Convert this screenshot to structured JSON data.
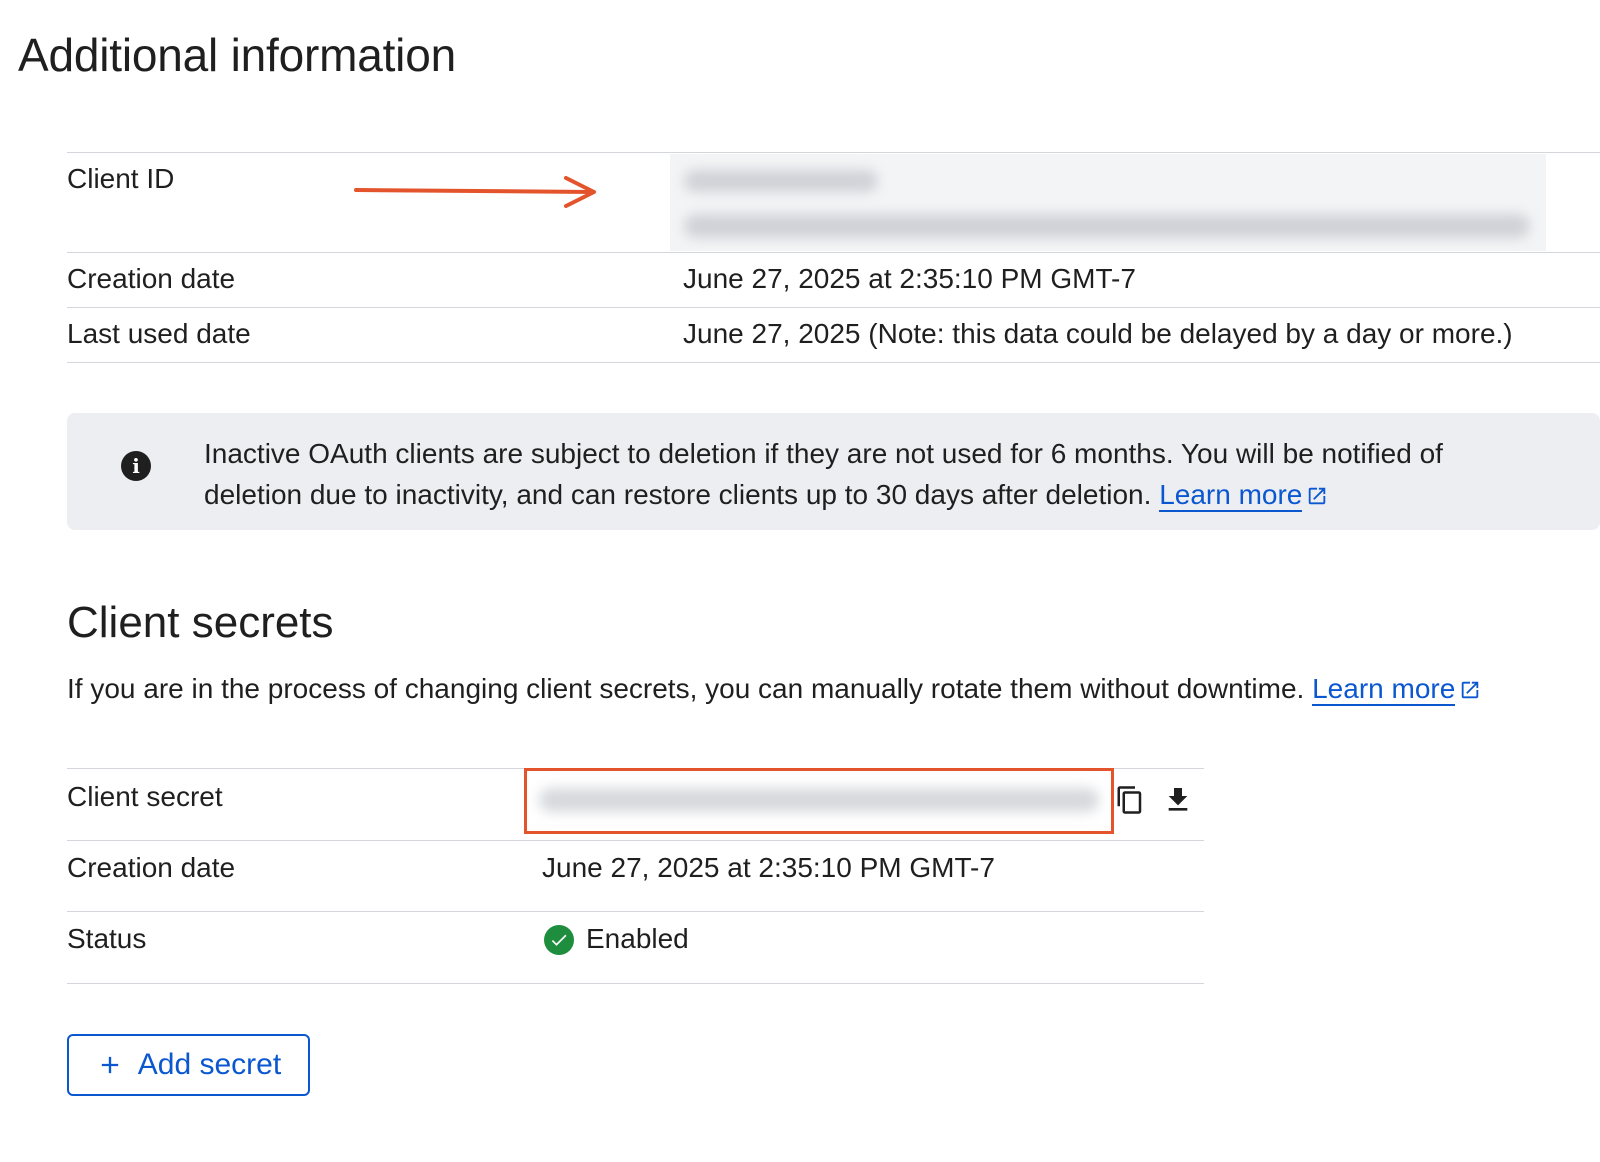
{
  "page": {
    "title": "Additional information"
  },
  "client_info": {
    "rows": [
      {
        "label": "Client ID",
        "value_redacted": true
      },
      {
        "label": "Creation date",
        "value": "June 27, 2025 at 2:35:10 PM GMT-7"
      },
      {
        "label": "Last used date",
        "value": "June 27, 2025 (Note: this data could be delayed by a day or more.)"
      }
    ]
  },
  "annotation": {
    "arrow_color": "#e4542c",
    "highlight_color": "#e4542c"
  },
  "notice": {
    "icon": "info-icon",
    "text": "Inactive OAuth clients are subject to deletion if they are not used for 6 months. You will be notified of deletion due to inactivity, and can restore clients up to 30 days after deletion.",
    "link_label": "Learn more"
  },
  "client_secrets": {
    "title": "Client secrets",
    "description": "If you are in the process of changing client secrets, you can manually rotate them without downtime.",
    "link_label": "Learn more",
    "rows": [
      {
        "label": "Client secret",
        "value_redacted": true,
        "icons": [
          "copy-icon",
          "download-icon"
        ]
      },
      {
        "label": "Creation date",
        "value": "June 27, 2025 at 2:35:10 PM GMT-7"
      },
      {
        "label": "Status",
        "value": "Enabled",
        "status_color": "#1e8e3e"
      }
    ],
    "add_button_label": "Add secret"
  },
  "colors": {
    "link": "#0b57d0",
    "text": "#1f1f1f",
    "notice_bg": "#eceef2",
    "divider": "#d3d6da"
  }
}
